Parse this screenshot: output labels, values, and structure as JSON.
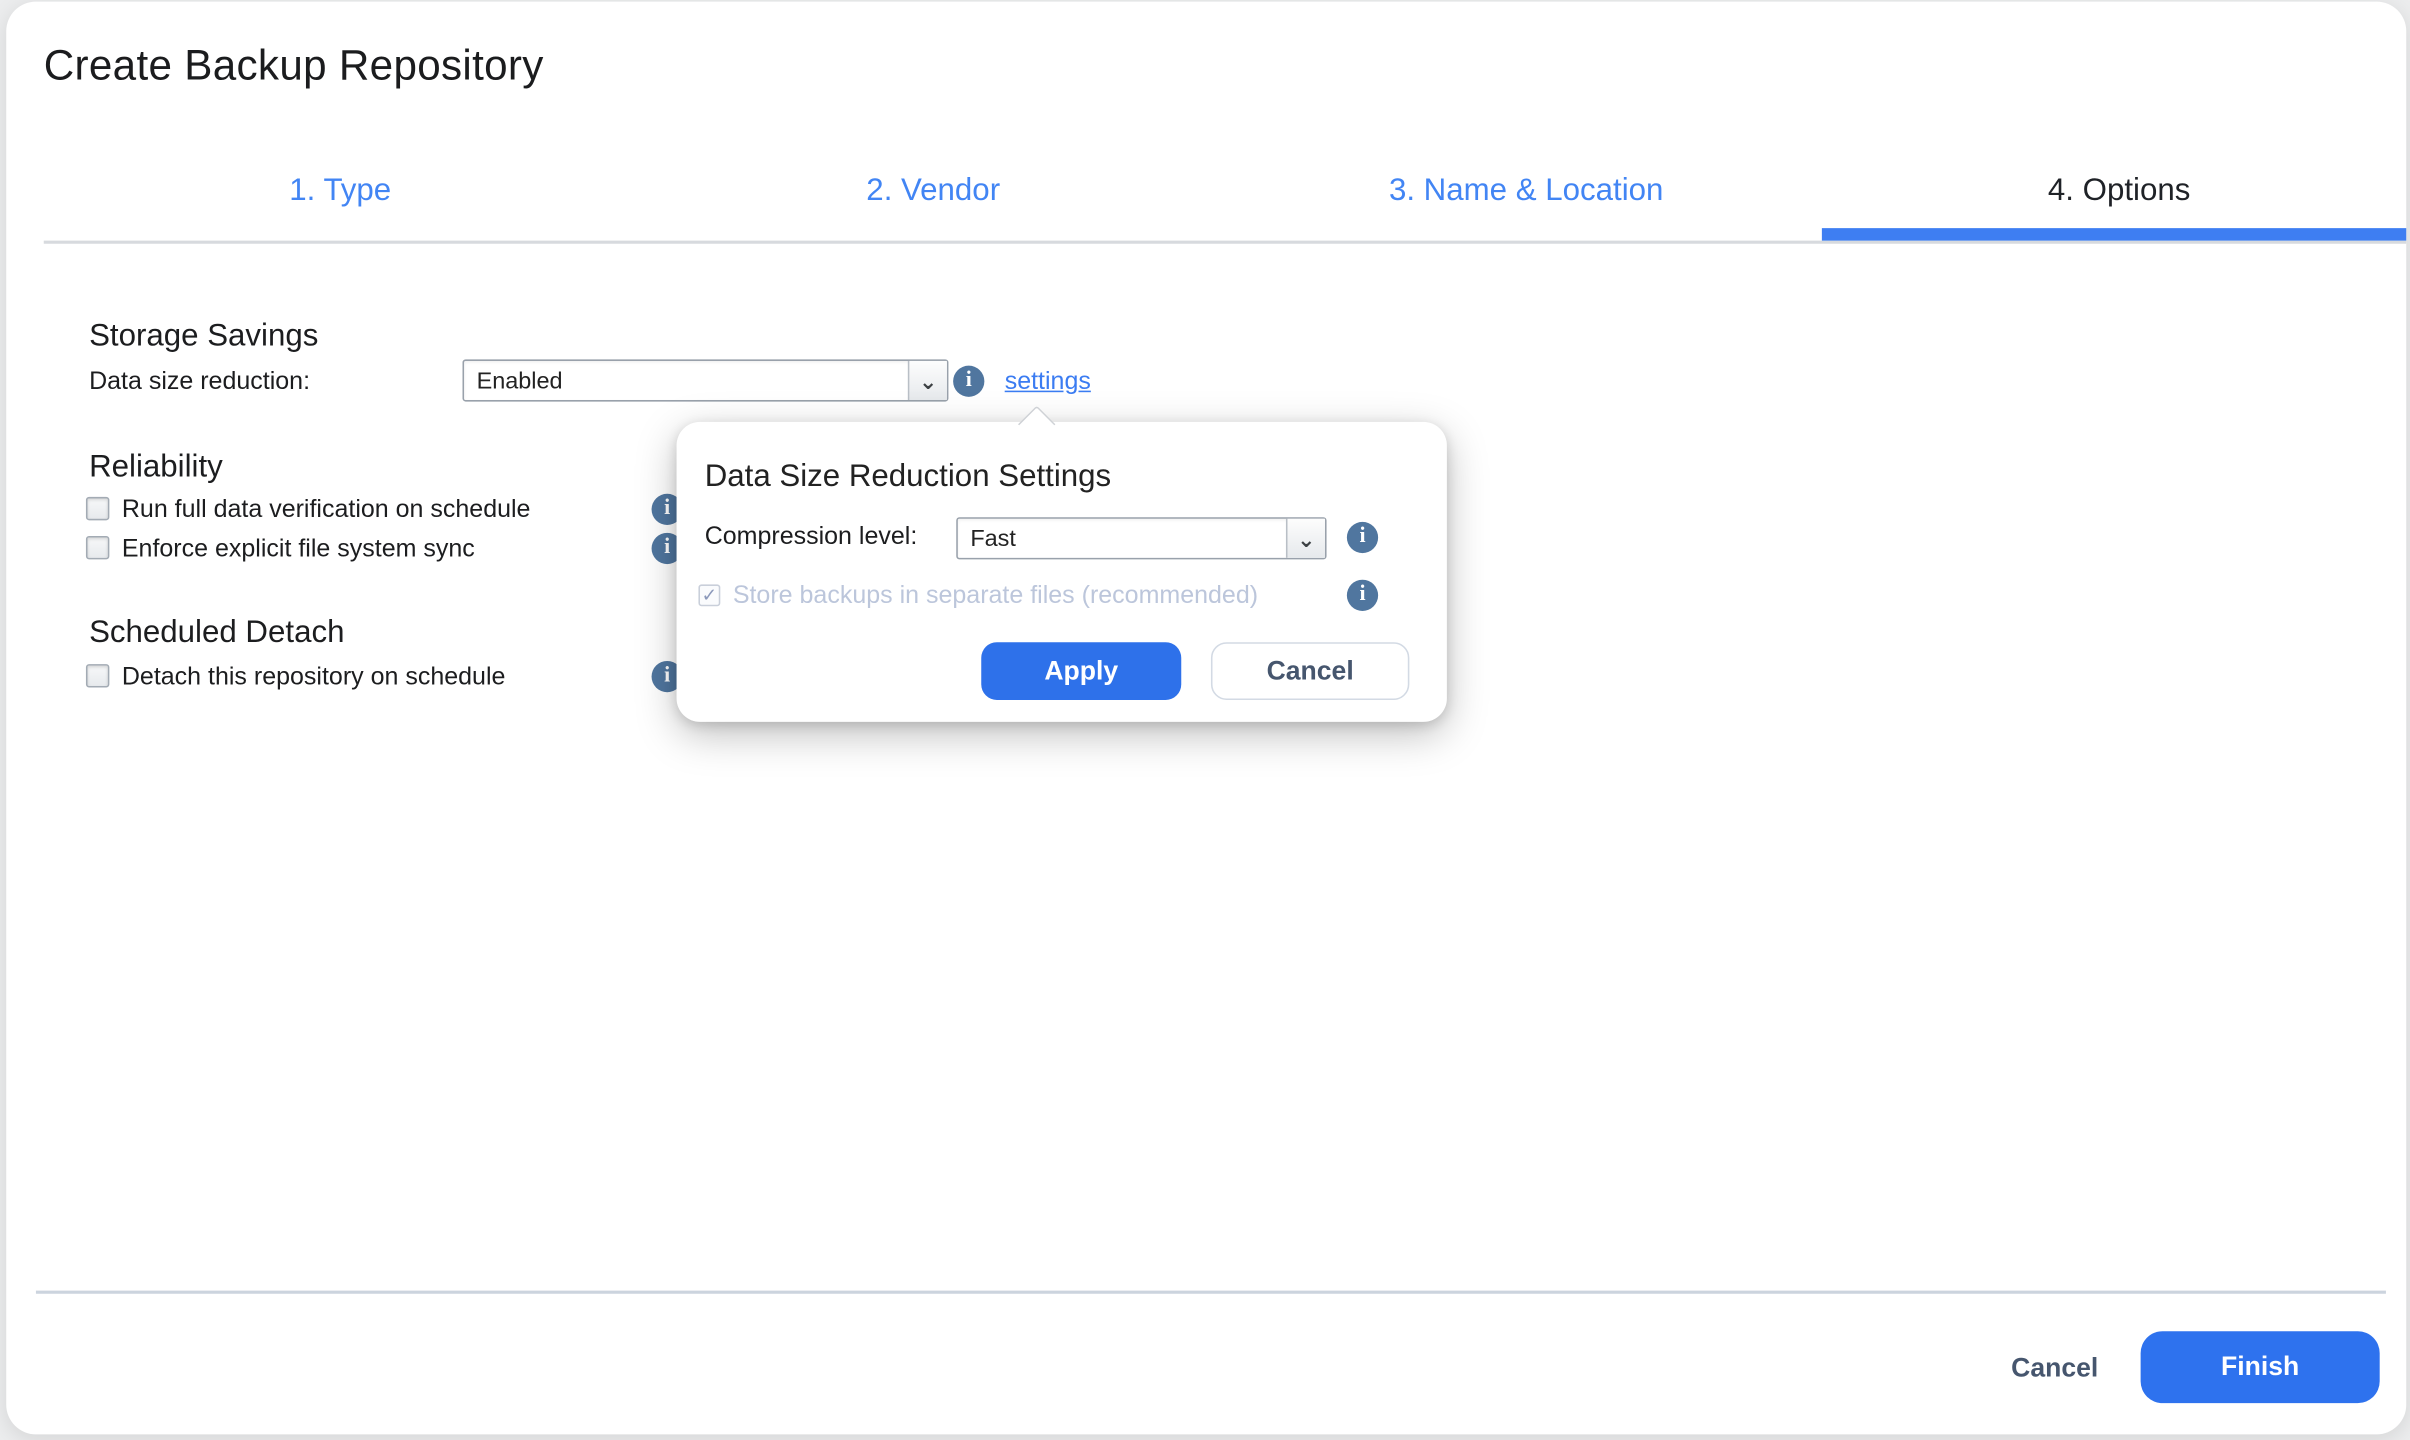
{
  "window": {
    "title": "Create Backup Repository"
  },
  "tabs": [
    {
      "label": "1. Type",
      "active": false
    },
    {
      "label": "2. Vendor",
      "active": false
    },
    {
      "label": "3. Name & Location",
      "active": false
    },
    {
      "label": "4. Options",
      "active": true
    }
  ],
  "sections": {
    "storage_savings": {
      "heading": "Storage Savings",
      "field_label": "Data size reduction:",
      "select_value": "Enabled",
      "settings_link": "settings"
    },
    "reliability": {
      "heading": "Reliability",
      "checkboxes": [
        {
          "label": "Run full data verification on schedule",
          "checked": false
        },
        {
          "label": "Enforce explicit file system sync",
          "checked": false
        }
      ]
    },
    "scheduled_detach": {
      "heading": "Scheduled Detach",
      "checkboxes": [
        {
          "label": "Detach this repository on schedule",
          "checked": false
        }
      ]
    }
  },
  "popover": {
    "title": "Data Size Reduction Settings",
    "compression_label": "Compression level:",
    "compression_value": "Fast",
    "store_checkbox": {
      "label": "Store backups in separate files (recommended)",
      "checked": true,
      "disabled": true
    },
    "apply_label": "Apply",
    "cancel_label": "Cancel"
  },
  "footer": {
    "cancel_label": "Cancel",
    "finish_label": "Finish"
  },
  "icons": {
    "info_glyph": "i",
    "chevron_glyph": "⌄",
    "check_glyph": "✓"
  },
  "colors": {
    "accent_blue": "#2e72ee",
    "tab_link_blue": "#4285f4",
    "underline_blue": "#3e7ef2",
    "info_icon_blue": "#50769f",
    "disabled_text": "#bcc6db",
    "dialog_bg": "#ffffff",
    "canvas_bg": "#ecedee"
  }
}
